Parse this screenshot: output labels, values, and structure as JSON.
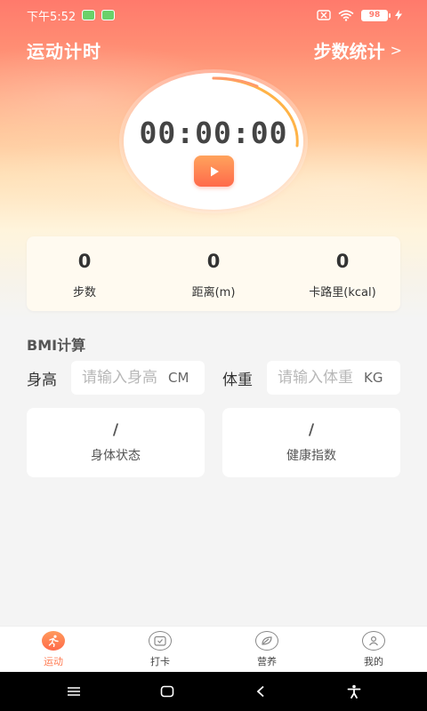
{
  "status_bar": {
    "time": "下午5:52",
    "battery": "98"
  },
  "header": {
    "title": "运动计时",
    "steps_link": "步数统计"
  },
  "timer": {
    "display": "00:00:00"
  },
  "stats": [
    {
      "value": "0",
      "label": "步数"
    },
    {
      "value": "0",
      "label": "距离(m)"
    },
    {
      "value": "0",
      "label": "卡路里(kcal)"
    }
  ],
  "bmi": {
    "title": "BMI计算",
    "height_label": "身高",
    "height_placeholder": "请输入身高",
    "height_unit": "CM",
    "weight_label": "体重",
    "weight_placeholder": "请输入体重",
    "weight_unit": "KG",
    "body_status_value": "/",
    "body_status_label": "身体状态",
    "health_index_value": "/",
    "health_index_label": "健康指数"
  },
  "bottom_nav": [
    {
      "label": "运动",
      "icon": "running-icon",
      "active": true
    },
    {
      "label": "打卡",
      "icon": "checkin-icon",
      "active": false
    },
    {
      "label": "营养",
      "icon": "nutrition-icon",
      "active": false
    },
    {
      "label": "我的",
      "icon": "profile-icon",
      "active": false
    }
  ],
  "colors": {
    "accent": "#ff7a50",
    "hero_top": "#ff7a6c",
    "arc": "#ffb347"
  }
}
